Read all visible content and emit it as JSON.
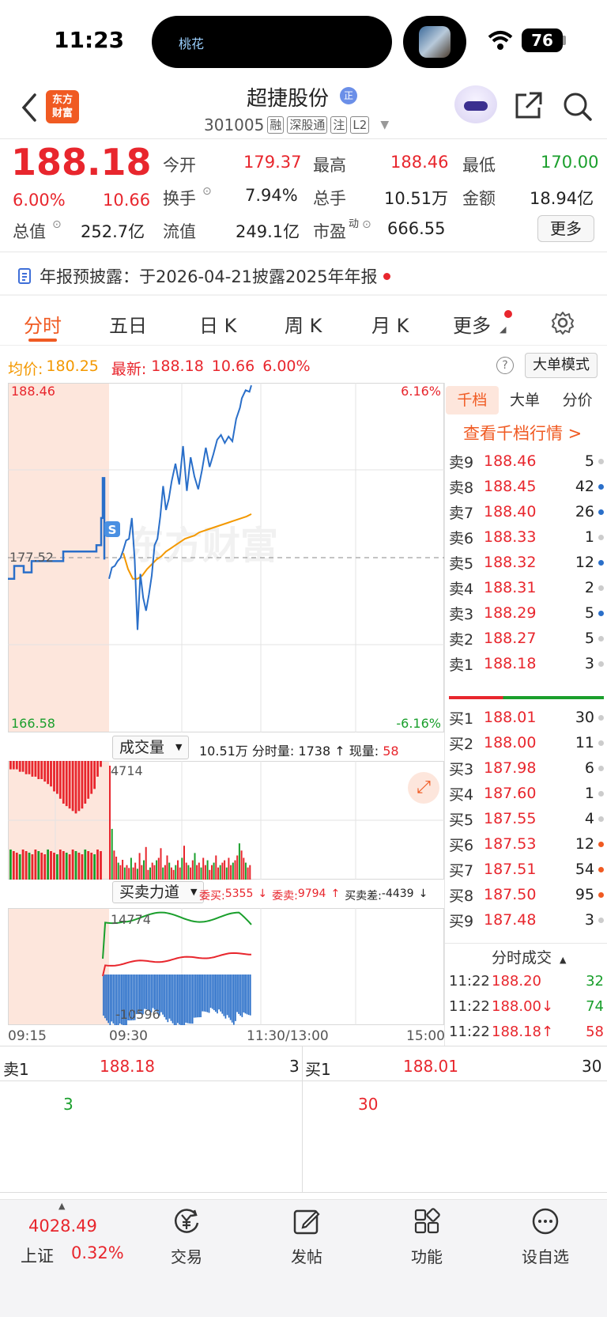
{
  "status_bar": {
    "time": "11:23",
    "island_text": "桃花",
    "battery": "76"
  },
  "header": {
    "logo_text": "东方\n财富",
    "stock_name": "超捷股份",
    "name_badge": "正",
    "stock_code": "301005",
    "tags": [
      "融",
      "深股通",
      "注",
      "L2"
    ]
  },
  "quote": {
    "price": "188.18",
    "change_pct": "6.00%",
    "change_amt": "10.66",
    "open_label": "今开",
    "open": "179.37",
    "high_label": "最高",
    "high": "188.46",
    "low_label": "最低",
    "low": "170.00",
    "turnover_label": "换手",
    "turnover": "7.94%",
    "volume_label": "总手",
    "volume": "10.51万",
    "amount_label": "金额",
    "amount": "18.94亿",
    "mktcap_label": "总值",
    "mktcap": "252.7亿",
    "float_label": "流值",
    "float_cap": "249.1亿",
    "pe_label": "市盈",
    "pe_sup": "动",
    "pe": "666.55",
    "more_label": "更多"
  },
  "notice": {
    "text": "年报预披露：于2026-04-21披露2025年年报"
  },
  "tabs": [
    "分时",
    "五日",
    "日 K",
    "周 K",
    "月 K",
    "更多"
  ],
  "info_bar": {
    "avg_label": "均价:",
    "avg": "180.25",
    "last_label": "最新:",
    "last": "188.18",
    "last_chg": "10.66",
    "last_pct": "6.00%",
    "big_order_mode": "大单模式"
  },
  "chart_data": [
    {
      "type": "line",
      "title": "分时",
      "x_ticks": [
        "09:15",
        "09:30",
        "11:30/13:00",
        "15:00"
      ],
      "y_high_label": "188.46",
      "y_low_label": "166.58",
      "y_ref_label": "177.52",
      "pct_high_label": "6.16%",
      "pct_low_label": "-6.16%",
      "ylim": [
        166.58,
        188.46
      ],
      "watermark": "东方财富",
      "series": [
        {
          "name": "price",
          "color": "#2a6fc9",
          "x": [
            0,
            3,
            6,
            9,
            12,
            15,
            18,
            21,
            24,
            27,
            30,
            33,
            36,
            39,
            42,
            45,
            48,
            51,
            54,
            57,
            60,
            63,
            66,
            70,
            74,
            78,
            82,
            86,
            90,
            94,
            98,
            102,
            106,
            110,
            114,
            118,
            122,
            126,
            130,
            134,
            138,
            140,
            144,
            148,
            150
          ],
          "values": [
            176.2,
            176.9,
            177.0,
            177.3,
            177.5,
            178.0,
            178.6,
            178.7,
            180.0,
            177.4,
            173.0,
            176.5,
            175.0,
            174.2,
            175.2,
            176.4,
            178.3,
            178.7,
            180.1,
            182.0,
            180.5,
            181.2,
            182.3,
            183.4,
            182.1,
            184.5,
            181.7,
            183.8,
            182.6,
            181.8,
            183.0,
            184.4,
            183.2,
            184.0,
            184.9,
            185.2,
            184.7,
            185.1,
            184.8,
            186.2,
            186.9,
            187.5,
            188.0,
            187.9,
            188.3
          ]
        },
        {
          "name": "avg",
          "color": "#f39800",
          "x": [
            15,
            20,
            25,
            30,
            35,
            40,
            45,
            50,
            55,
            60,
            65,
            70,
            75,
            80,
            85,
            90,
            95,
            100,
            105,
            110,
            115,
            120,
            125,
            130,
            135,
            140,
            145,
            150
          ],
          "values": [
            177.8,
            176.8,
            176.2,
            176.2,
            176.4,
            176.8,
            177.1,
            177.4,
            177.6,
            177.9,
            178.1,
            178.3,
            178.5,
            178.7,
            178.8,
            178.9,
            179.1,
            179.2,
            179.3,
            179.4,
            179.5,
            179.6,
            179.7,
            179.8,
            179.9,
            180.0,
            180.1,
            180.25
          ]
        }
      ]
    },
    {
      "type": "bar",
      "title": "成交量",
      "total": "10.51万",
      "per_min_label": "分时量:",
      "per_min": "1738",
      "now_label": "现量:",
      "now": "58",
      "y_max_label": "4714",
      "pre_open_values": [
        4500,
        4500,
        4500,
        4400,
        4400,
        4300,
        4300,
        4200,
        4200,
        4100,
        4100,
        4000,
        3900,
        3800,
        3600,
        3500,
        3300,
        3100,
        3000,
        2900,
        2800,
        2700,
        2800,
        2900,
        3100,
        3300,
        3500,
        3700,
        4200,
        4600
      ],
      "values": [
        4714,
        2100,
        1200,
        950,
        700,
        600,
        820,
        500,
        600,
        480,
        900,
        500,
        700,
        450,
        1100,
        600,
        800,
        1350,
        400,
        500,
        700,
        600,
        800,
        900,
        1300,
        500,
        600,
        1000,
        700,
        500,
        400,
        600,
        800,
        500,
        900,
        1400,
        700,
        600,
        500,
        800,
        1100,
        600,
        700,
        500,
        900,
        600,
        800,
        400,
        600,
        700,
        1000,
        500,
        600,
        700,
        800,
        500,
        900,
        600,
        700,
        800,
        1000,
        1500,
        1200,
        900,
        700,
        500,
        600
      ]
    },
    {
      "type": "line",
      "title": "买卖力道",
      "buy_label": "委买:",
      "buy": "5355",
      "sell_label": "委卖:",
      "sell": "9794",
      "diff_label": "买卖差:",
      "diff": "-4439",
      "y_max_label": "14774",
      "y_min_label": "-10596"
    }
  ],
  "order_book": {
    "tabs": [
      "千档",
      "大单",
      "分价"
    ],
    "link": "查看千档行情 >",
    "asks": [
      {
        "k": "卖9",
        "p": "188.46",
        "q": "5",
        "dot": "gray"
      },
      {
        "k": "卖8",
        "p": "188.45",
        "q": "42",
        "dot": "blue"
      },
      {
        "k": "卖7",
        "p": "188.40",
        "q": "26",
        "dot": "blue"
      },
      {
        "k": "卖6",
        "p": "188.33",
        "q": "1",
        "dot": "gray"
      },
      {
        "k": "卖5",
        "p": "188.32",
        "q": "12",
        "dot": "blue"
      },
      {
        "k": "卖4",
        "p": "188.31",
        "q": "2",
        "dot": "gray"
      },
      {
        "k": "卖3",
        "p": "188.29",
        "q": "5",
        "dot": "blue"
      },
      {
        "k": "卖2",
        "p": "188.27",
        "q": "5",
        "dot": "gray"
      },
      {
        "k": "卖1",
        "p": "188.18",
        "q": "3",
        "dot": "gray"
      }
    ],
    "bids": [
      {
        "k": "买1",
        "p": "188.01",
        "q": "30",
        "dot": "gray"
      },
      {
        "k": "买2",
        "p": "188.00",
        "q": "11",
        "dot": "gray"
      },
      {
        "k": "买3",
        "p": "187.98",
        "q": "6",
        "dot": "gray"
      },
      {
        "k": "买4",
        "p": "187.60",
        "q": "1",
        "dot": "gray"
      },
      {
        "k": "买5",
        "p": "187.55",
        "q": "4",
        "dot": "gray"
      },
      {
        "k": "买6",
        "p": "187.53",
        "q": "12",
        "dot": "orange"
      },
      {
        "k": "买7",
        "p": "187.51",
        "q": "54",
        "dot": "orange"
      },
      {
        "k": "买8",
        "p": "187.50",
        "q": "95",
        "dot": "orange"
      },
      {
        "k": "买9",
        "p": "187.48",
        "q": "3",
        "dot": "gray"
      }
    ],
    "trades_title": "分时成交",
    "trades": [
      {
        "t": "11:22",
        "p": "188.20",
        "dir": "",
        "q": "32",
        "pc": "red",
        "qc": "green"
      },
      {
        "t": "11:22",
        "p": "188.00",
        "dir": "↓",
        "q": "74",
        "pc": "red",
        "qc": "green"
      },
      {
        "t": "11:22",
        "p": "188.18",
        "dir": "↑",
        "q": "58",
        "pc": "red",
        "qc": "red"
      }
    ]
  },
  "bottom_quote": {
    "ask_label": "卖1",
    "ask_price": "188.18",
    "ask_qty": "3",
    "ask_sub": "3",
    "bid_label": "买1",
    "bid_price": "188.01",
    "bid_qty": "30",
    "bid_sub": "30"
  },
  "nav": {
    "index_value": "4028.49",
    "index_name": "上证",
    "index_pct": "0.32%",
    "items": [
      "交易",
      "发帖",
      "功能",
      "设自选"
    ]
  }
}
